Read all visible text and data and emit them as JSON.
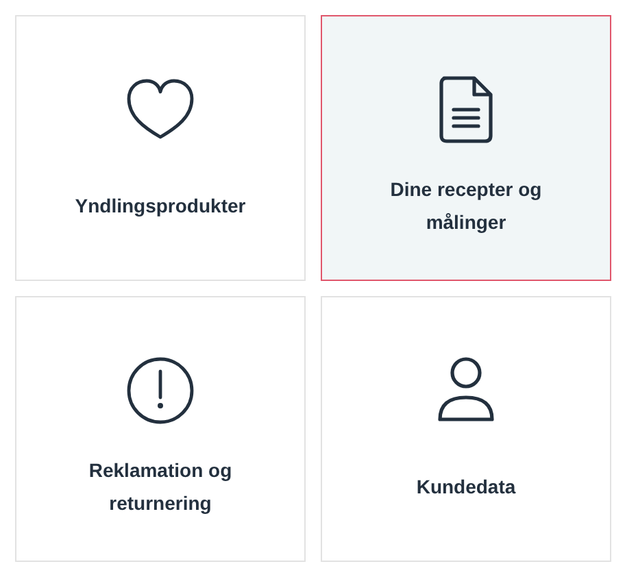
{
  "tiles": [
    {
      "kind": "heart",
      "label": "Yndlingsprodukter",
      "selected": false
    },
    {
      "kind": "document",
      "label": "Dine recepter og målinger",
      "selected": true
    },
    {
      "kind": "alert",
      "label": "Reklamation og returnering",
      "selected": false
    },
    {
      "kind": "person",
      "label": "Kundedata",
      "selected": false
    }
  ]
}
